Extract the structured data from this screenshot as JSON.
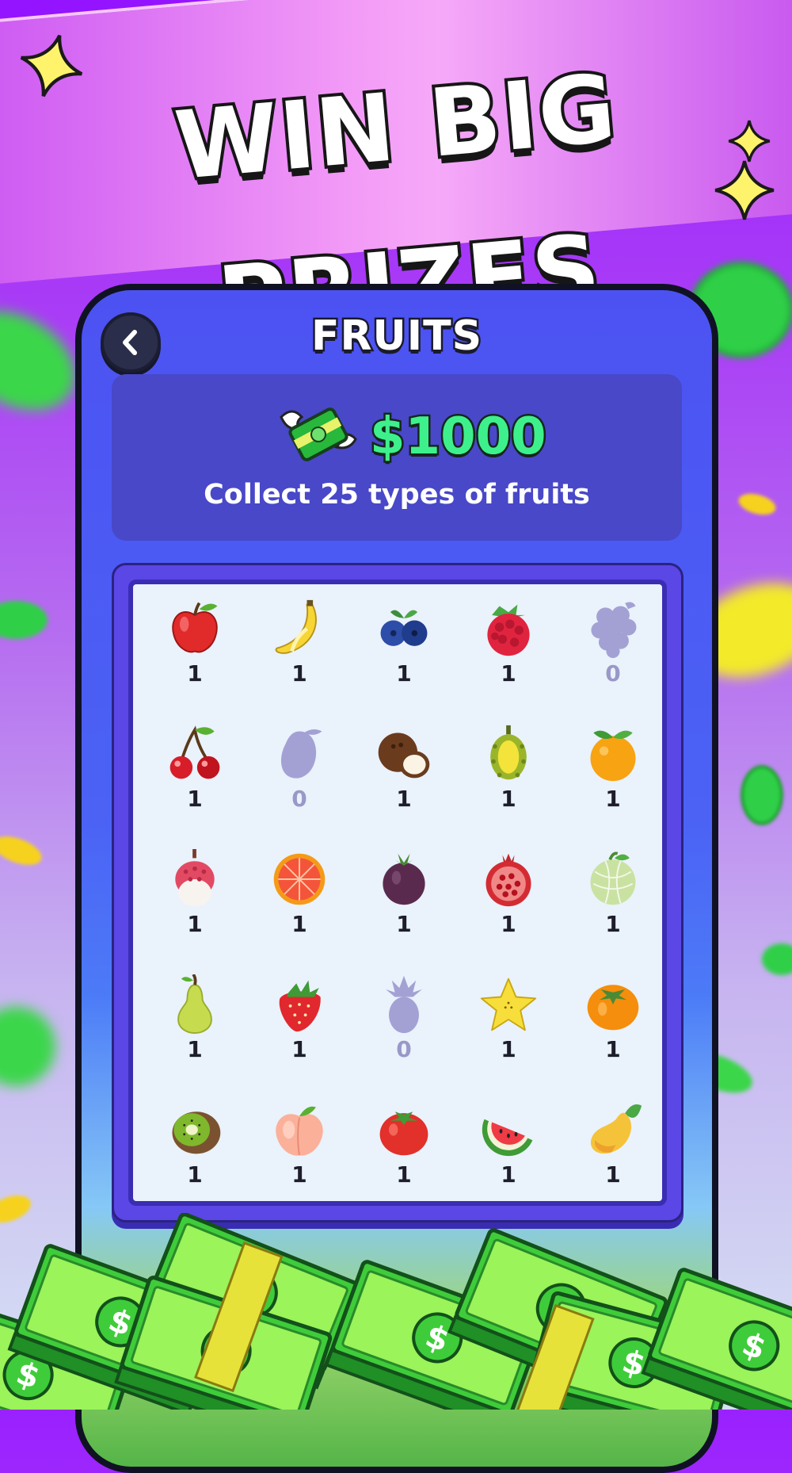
{
  "headline": "WIN BIG PRIZES",
  "screen": {
    "title": "FRUITS",
    "back_icon": "chevron-left-icon",
    "prize_amount": "$1000",
    "prize_description": "Collect 25 types of fruits"
  },
  "colors": {
    "background_purple": "#9a21ff",
    "phone_panel": "#4c52f2",
    "prize_green": "#3ef08c",
    "grid_background": "#eaf2fb",
    "locked_gray": "#9a98c8"
  },
  "fruits": [
    {
      "name": "apple",
      "count": "1"
    },
    {
      "name": "banana",
      "count": "1"
    },
    {
      "name": "blueberry",
      "count": "1"
    },
    {
      "name": "raspberry",
      "count": "1"
    },
    {
      "name": "grapes",
      "count": "0"
    },
    {
      "name": "cherry",
      "count": "1"
    },
    {
      "name": "lemon",
      "count": "0"
    },
    {
      "name": "coconut",
      "count": "1"
    },
    {
      "name": "durian",
      "count": "1"
    },
    {
      "name": "tangerine",
      "count": "1"
    },
    {
      "name": "lychee",
      "count": "1"
    },
    {
      "name": "grapefruit",
      "count": "1"
    },
    {
      "name": "mangosteen",
      "count": "1"
    },
    {
      "name": "pomegranate",
      "count": "1"
    },
    {
      "name": "melon",
      "count": "1"
    },
    {
      "name": "pear",
      "count": "1"
    },
    {
      "name": "strawberry",
      "count": "1"
    },
    {
      "name": "pineapple",
      "count": "0"
    },
    {
      "name": "starfruit",
      "count": "1"
    },
    {
      "name": "persimmon",
      "count": "1"
    },
    {
      "name": "kiwi",
      "count": "1"
    },
    {
      "name": "peach",
      "count": "1"
    },
    {
      "name": "tomato",
      "count": "1"
    },
    {
      "name": "watermelon",
      "count": "1"
    },
    {
      "name": "mango",
      "count": "1"
    }
  ]
}
